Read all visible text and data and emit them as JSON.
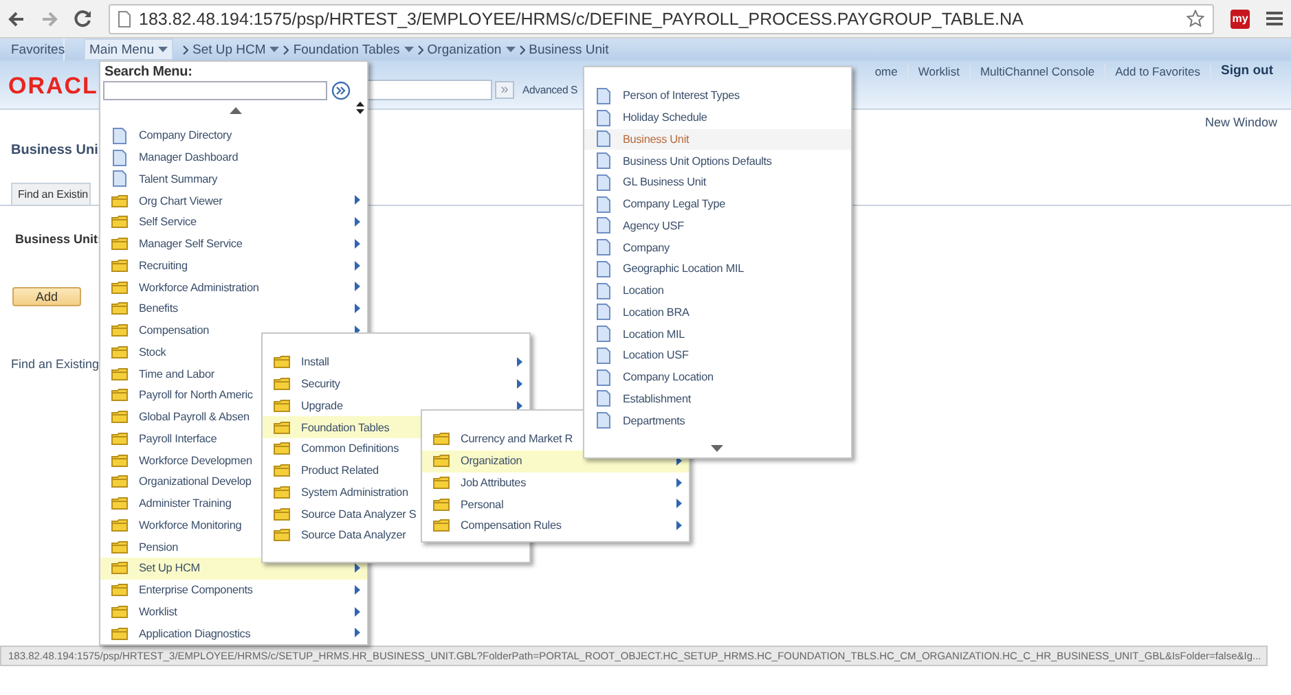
{
  "browser": {
    "url": "183.82.48.194:1575/psp/HRTEST_3/EMPLOYEE/HRMS/c/DEFINE_PAYROLL_PROCESS.PAYGROUP_TABLE.NA",
    "app_badge": "my"
  },
  "nav_bar": {
    "favorites": "Favorites",
    "main_menu": "Main Menu",
    "breadcrumbs": [
      {
        "label": "Set Up HCM",
        "dropdown": true
      },
      {
        "label": "Foundation Tables",
        "dropdown": true
      },
      {
        "label": "Organization",
        "dropdown": true
      },
      {
        "label": "Business Unit",
        "dropdown": false
      }
    ]
  },
  "header": {
    "logo": "ORACL",
    "search_button": "»",
    "advanced_search": "Advanced S",
    "links": [
      {
        "label": "ome",
        "kind": "link"
      },
      {
        "label": "Worklist",
        "kind": "link"
      },
      {
        "label": "MultiChannel Console",
        "kind": "link"
      },
      {
        "label": "Add to Favorites",
        "kind": "link"
      },
      {
        "label": "Sign out",
        "kind": "signout"
      }
    ]
  },
  "new_window": "New Window",
  "page": {
    "title": "Business Uni",
    "tab": "Find an Existin",
    "field_label": "Business Unit:",
    "add_button": "Add",
    "find_link": "Find an Existing"
  },
  "main_menu_dropdown": {
    "search_label": "Search Menu:",
    "items": [
      {
        "label": "Company Directory",
        "kind": "page",
        "selected": false
      },
      {
        "label": "Manager Dashboard",
        "kind": "page",
        "selected": false
      },
      {
        "label": "Talent Summary",
        "kind": "page",
        "selected": false
      },
      {
        "label": "Org Chart Viewer",
        "kind": "folder",
        "selected": false
      },
      {
        "label": "Self Service",
        "kind": "folder",
        "selected": false
      },
      {
        "label": "Manager Self Service",
        "kind": "folder",
        "selected": false
      },
      {
        "label": "Recruiting",
        "kind": "folder",
        "selected": false
      },
      {
        "label": "Workforce Administration",
        "kind": "folder",
        "selected": false
      },
      {
        "label": "Benefits",
        "kind": "folder",
        "selected": false
      },
      {
        "label": "Compensation",
        "kind": "folder",
        "selected": false
      },
      {
        "label": "Stock",
        "kind": "folder",
        "selected": false
      },
      {
        "label": "Time and Labor",
        "kind": "folder",
        "selected": false
      },
      {
        "label": "Payroll for North Americ",
        "kind": "folder",
        "selected": false
      },
      {
        "label": "Global Payroll & Absen",
        "kind": "folder",
        "selected": false
      },
      {
        "label": "Payroll Interface",
        "kind": "folder",
        "selected": false
      },
      {
        "label": "Workforce Developmen",
        "kind": "folder",
        "selected": false
      },
      {
        "label": "Organizational Develop",
        "kind": "folder",
        "selected": false
      },
      {
        "label": "Administer Training",
        "kind": "folder",
        "selected": false
      },
      {
        "label": "Workforce Monitoring",
        "kind": "folder",
        "selected": false
      },
      {
        "label": "Pension",
        "kind": "folder",
        "selected": false
      },
      {
        "label": "Set Up HCM",
        "kind": "folder",
        "selected": true
      },
      {
        "label": "Enterprise Components",
        "kind": "folder",
        "selected": false
      },
      {
        "label": "Worklist",
        "kind": "folder",
        "selected": false
      },
      {
        "label": "Application Diagnostics",
        "kind": "folder",
        "selected": false
      }
    ]
  },
  "submenus": [
    {
      "items": [
        {
          "label": "Install",
          "kind": "folder",
          "selected": false
        },
        {
          "label": "Security",
          "kind": "folder",
          "selected": false
        },
        {
          "label": "Upgrade",
          "kind": "folder",
          "selected": false
        },
        {
          "label": "Foundation Tables",
          "kind": "folder",
          "selected": true
        },
        {
          "label": "Common Definitions",
          "kind": "folder",
          "selected": false
        },
        {
          "label": "Product Related",
          "kind": "folder",
          "selected": false
        },
        {
          "label": "System Administration",
          "kind": "folder",
          "selected": false
        },
        {
          "label": "Source Data Analyzer S",
          "kind": "folder",
          "selected": false
        },
        {
          "label": "Source Data Analyzer",
          "kind": "folder",
          "selected": false
        }
      ]
    },
    {
      "items": [
        {
          "label": "Currency and Market R",
          "kind": "folder",
          "selected": false
        },
        {
          "label": "Organization",
          "kind": "folder",
          "selected": true
        },
        {
          "label": "Job Attributes",
          "kind": "folder",
          "selected": false
        },
        {
          "label": "Personal",
          "kind": "folder",
          "selected": false
        },
        {
          "label": "Compensation Rules",
          "kind": "folder",
          "selected": false
        }
      ]
    },
    {
      "items": [
        {
          "label": "Person of Interest Types",
          "kind": "page",
          "selected": false
        },
        {
          "label": "Holiday Schedule",
          "kind": "page",
          "selected": false
        },
        {
          "label": "Business Unit",
          "kind": "page",
          "selected": true
        },
        {
          "label": "Business Unit Options Defaults",
          "kind": "page",
          "selected": false
        },
        {
          "label": "GL Business Unit",
          "kind": "page",
          "selected": false
        },
        {
          "label": "Company Legal Type",
          "kind": "page",
          "selected": false
        },
        {
          "label": "Agency USF",
          "kind": "page",
          "selected": false
        },
        {
          "label": "Company",
          "kind": "page",
          "selected": false
        },
        {
          "label": "Geographic Location MIL",
          "kind": "page",
          "selected": false
        },
        {
          "label": "Location",
          "kind": "page",
          "selected": false
        },
        {
          "label": "Location BRA",
          "kind": "page",
          "selected": false
        },
        {
          "label": "Location MIL",
          "kind": "page",
          "selected": false
        },
        {
          "label": "Location USF",
          "kind": "page",
          "selected": false
        },
        {
          "label": "Company Location",
          "kind": "page",
          "selected": false
        },
        {
          "label": "Establishment",
          "kind": "page",
          "selected": false
        },
        {
          "label": "Departments",
          "kind": "page",
          "selected": false
        }
      ]
    }
  ],
  "status_bar": "183.82.48.194:1575/psp/HRTEST_3/EMPLOYEE/HRMS/c/SETUP_HRMS.HR_BUSINESS_UNIT.GBL?FolderPath=PORTAL_ROOT_OBJECT.HC_SETUP_HRMS.HC_FOUNDATION_TBLS.HC_CM_ORGANIZATION.HC_C_HR_BUSINESS_UNIT_GBL&IsFolder=false&Ig..."
}
